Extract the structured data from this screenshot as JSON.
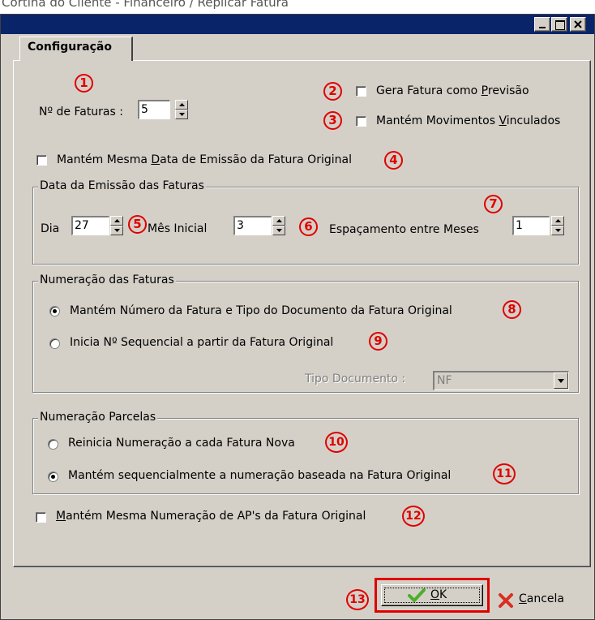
{
  "caption": "Cortina do Cliente - Financeiro / Replicar Fatura",
  "window": {
    "title_buttons": [
      "minimize-icon",
      "maximize-icon",
      "close-icon"
    ]
  },
  "tab": {
    "label": "Configuração"
  },
  "invoices": {
    "label": "Nº de Faturas :",
    "value": "5"
  },
  "forecast": {
    "label_pre": "Gera Fatura como ",
    "label_u": "P",
    "label_post": "revisão",
    "checked": false
  },
  "linked": {
    "label_pre": "Mantém Movimentos ",
    "label_u": "V",
    "label_post": "inculados",
    "checked": false
  },
  "same_date": {
    "label_pre": "Mantém Mesma ",
    "label_u": "D",
    "label_post": "ata de Emissão da Fatura Original",
    "checked": false
  },
  "emission": {
    "legend": "Data da Emissão das Faturas",
    "day_label": "Dia",
    "day_value": "27",
    "month_label": "Mês Inicial",
    "month_value": "3",
    "spacing_label": "Espaçamento entre Meses",
    "spacing_value": "1"
  },
  "numbering": {
    "legend": "Numeração das Faturas",
    "option1": "Mantém Número da Fatura  e Tipo do Documento da Fatura Original",
    "option2": "Inicia Nº Sequencial a partir da Fatura Original",
    "selected": 1,
    "doc_type_label": "Tipo Documento :",
    "doc_type_value": "NF"
  },
  "installments": {
    "legend": "Numeração Parcelas",
    "option1": "Reinicia Numeração a cada Fatura Nova",
    "option2": "Mantém sequencialmente a numeração baseada na Fatura Original",
    "selected": 2
  },
  "ap": {
    "label_pre": "",
    "label_u": "M",
    "label_post": "antém Mesma Numeração de AP's da Fatura Original",
    "checked": false
  },
  "buttons": {
    "ok_u": "O",
    "ok_rest": "K",
    "cancel_u": "C",
    "cancel_rest": "ancela"
  },
  "annotations": [
    "1",
    "2",
    "3",
    "4",
    "5",
    "6",
    "7",
    "8",
    "9",
    "10",
    "11",
    "12",
    "13"
  ],
  "colors": {
    "titlebar": "#0a246a",
    "dialog": "#d4d0c8",
    "annotation": "#e00000"
  }
}
